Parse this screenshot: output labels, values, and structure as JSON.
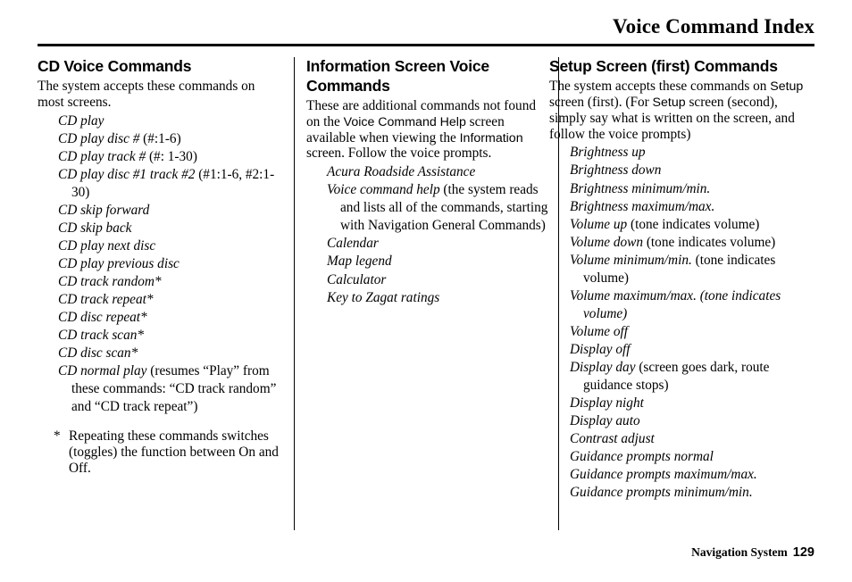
{
  "header": {
    "title": "Voice Command Index"
  },
  "footer": {
    "label": "Navigation System",
    "page_number": "129"
  },
  "columns": [
    {
      "id": "cd-voice-commands",
      "title": "CD Voice Commands",
      "intro": [
        {
          "type": "text",
          "value": "The system accepts these commands on most screens."
        }
      ],
      "commands": [
        {
          "cmd": "CD play"
        },
        {
          "cmd": "CD play disc #",
          "note": " (#:1-6)"
        },
        {
          "cmd": "CD play track #",
          "note": " (#: 1-30)"
        },
        {
          "cmd": "CD play disc #1 track #2",
          "note": " (#1:1-6, #2:1-30)"
        },
        {
          "cmd": "CD skip forward"
        },
        {
          "cmd": "CD skip back"
        },
        {
          "cmd": "CD play next disc"
        },
        {
          "cmd": "CD play previous disc"
        },
        {
          "cmd": "CD track random*"
        },
        {
          "cmd": "CD track repeat*"
        },
        {
          "cmd": "CD disc repeat*"
        },
        {
          "cmd": "CD track scan*"
        },
        {
          "cmd": "CD disc scan*"
        },
        {
          "cmd": "CD normal play",
          "note": " (resumes “Play” from these commands: “CD track random” and “CD track repeat”)"
        }
      ],
      "footnote": {
        "mark": "*",
        "text": "Repeating these commands switches (toggles) the function between On and Off."
      }
    },
    {
      "id": "information-screen-voice-commands",
      "title": "Information Screen Voice Commands",
      "intro": [
        {
          "type": "text",
          "value": "These are additional commands not found on the "
        },
        {
          "type": "screen-label",
          "value": "Voice Command Help"
        },
        {
          "type": "text",
          "value": " screen available when viewing the "
        },
        {
          "type": "screen-label",
          "value": "Information"
        },
        {
          "type": "text",
          "value": " screen. Follow the voice prompts."
        }
      ],
      "commands": [
        {
          "cmd": "Acura Roadside Assistance"
        },
        {
          "cmd": "Voice command help",
          "note": " (the system reads and lists all of the commands, starting with Navigation General Commands)"
        },
        {
          "cmd": "Calendar"
        },
        {
          "cmd": "Map legend"
        },
        {
          "cmd": "Calculator"
        },
        {
          "cmd": "Key to Zagat ratings"
        }
      ],
      "footnote": null
    },
    {
      "id": "setup-screen-first-commands",
      "title": "Setup Screen (first) Commands",
      "intro": [
        {
          "type": "text",
          "value": "The system accepts these commands on "
        },
        {
          "type": "screen-label",
          "value": "Setup"
        },
        {
          "type": "text",
          "value": " screen (first). (For "
        },
        {
          "type": "screen-label",
          "value": "Setup"
        },
        {
          "type": "text",
          "value": " screen (second), simply say what is written on the screen, and follow the voice prompts)"
        }
      ],
      "commands": [
        {
          "cmd": "Brightness up"
        },
        {
          "cmd": "Brightness down"
        },
        {
          "cmd": "Brightness minimum/min."
        },
        {
          "cmd": "Brightness maximum/max."
        },
        {
          "cmd": "Volume up",
          "note": " (tone indicates volume)"
        },
        {
          "cmd": "Volume down",
          "note": " (tone indicates volume)"
        },
        {
          "cmd": "Volume minimum/min.",
          "note": " (tone indicates volume)"
        },
        {
          "cmd": "Volume maximum/max. (tone indicates volume)",
          "italic_note": true
        },
        {
          "cmd": "Volume off"
        },
        {
          "cmd": "Display off"
        },
        {
          "cmd": "Display day",
          "note": " (screen goes dark, route guidance stops)"
        },
        {
          "cmd": "Display night"
        },
        {
          "cmd": "Display auto"
        },
        {
          "cmd": "Contrast adjust"
        },
        {
          "cmd": "Guidance prompts normal"
        },
        {
          "cmd": "Guidance prompts maximum/max."
        },
        {
          "cmd": "Guidance prompts minimum/min."
        }
      ],
      "footnote": null
    }
  ]
}
